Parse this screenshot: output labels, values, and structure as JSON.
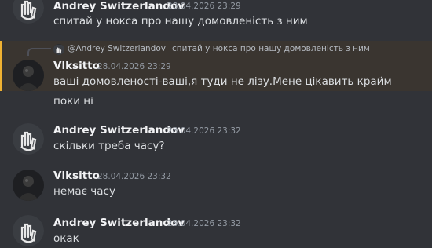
{
  "messages": [
    {
      "author": "Andrey Switzerlandov",
      "timestamp": "28.04.2026 23:29",
      "lines": [
        "спитай у нокса про нашу домовленість з ним"
      ],
      "avatar_icon": "hand-gesture-avatar"
    },
    {
      "author": "Vlksitto",
      "timestamp": "28.04.2026 23:29",
      "lines": [
        "ваші домовленості-ваші,я туди не лізу.Мене цікавить крайм",
        "поки ні"
      ],
      "avatar_icon": "dark-portrait-avatar",
      "highlighted": true,
      "highlight_color": "#f0b232",
      "reply": {
        "author": "@Andrey Switzerlandov",
        "text": "спитай у нокса про нашу домовленість з ним"
      }
    },
    {
      "author": "Andrey Switzerlandov",
      "timestamp": "28.04.2026 23:32",
      "lines": [
        "скільки треба часу?"
      ],
      "avatar_icon": "hand-gesture-avatar"
    },
    {
      "author": "Vlksitto",
      "timestamp": "28.04.2026 23:32",
      "lines": [
        "немає часу"
      ],
      "avatar_icon": "dark-portrait-avatar"
    },
    {
      "author": "Andrey Switzerlandov",
      "timestamp": "28.04.2026 23:32",
      "lines": [
        "окак"
      ],
      "avatar_icon": "hand-gesture-avatar"
    }
  ]
}
